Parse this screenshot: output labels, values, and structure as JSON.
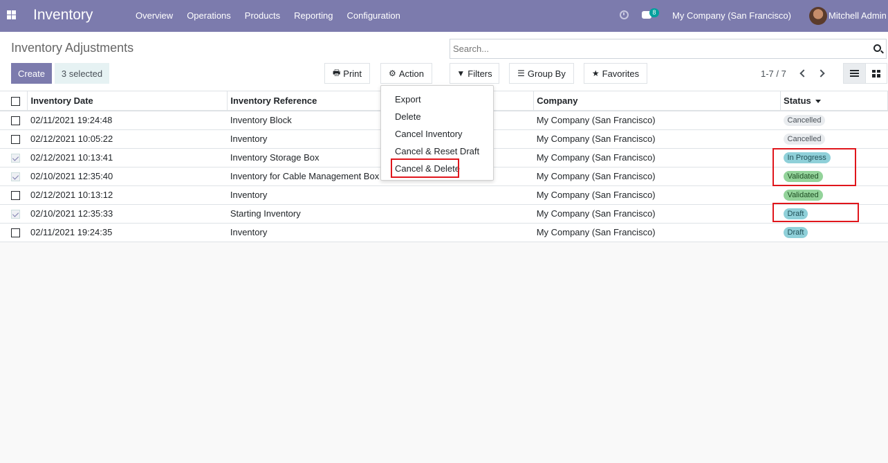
{
  "navbar": {
    "app_title": "Inventory",
    "menu": [
      "Overview",
      "Operations",
      "Products",
      "Reporting",
      "Configuration"
    ],
    "chat_count": "8",
    "company": "My Company (San Francisco)",
    "user": "Mitchell Admin",
    "bg_color": "#7c7bad"
  },
  "control_panel": {
    "title": "Inventory Adjustments",
    "create_label": "Create",
    "selected_label": "3 selected",
    "print_label": "Print",
    "action_label": "Action",
    "search_placeholder": "Search...",
    "filters_label": "Filters",
    "groupby_label": "Group By",
    "favorites_label": "Favorites",
    "pager": "1-7 / 7"
  },
  "action_menu": [
    "Export",
    "Delete",
    "Cancel Inventory",
    "Cancel & Reset Draft",
    "Cancel & Delete"
  ],
  "table": {
    "columns": [
      "Inventory Date",
      "Inventory Reference",
      "Company",
      "Status"
    ],
    "rows": [
      {
        "checked": false,
        "date": "02/11/2021 19:24:48",
        "reference": "Inventory Block",
        "company": "My Company (San Francisco)",
        "status": "Cancelled"
      },
      {
        "checked": false,
        "date": "02/12/2021 10:05:22",
        "reference": "Inventory",
        "company": "My Company (San Francisco)",
        "status": "Cancelled"
      },
      {
        "checked": true,
        "date": "02/12/2021 10:13:41",
        "reference": "Inventory Storage Box",
        "company": "My Company (San Francisco)",
        "status": "In Progress"
      },
      {
        "checked": true,
        "date": "02/10/2021 12:35:40",
        "reference": "Inventory for Cable Management Box",
        "company": "My Company (San Francisco)",
        "status": "Validated"
      },
      {
        "checked": false,
        "date": "02/12/2021 10:13:12",
        "reference": "Inventory",
        "company": "My Company (San Francisco)",
        "status": "Validated"
      },
      {
        "checked": true,
        "date": "02/10/2021 12:35:33",
        "reference": "Starting Inventory",
        "company": "My Company (San Francisco)",
        "status": "Draft"
      },
      {
        "checked": false,
        "date": "02/11/2021 19:24:35",
        "reference": "Inventory",
        "company": "My Company (San Francisco)",
        "status": "Draft"
      }
    ]
  },
  "status_colors": {
    "Cancelled": {
      "bg": "#e9ecef",
      "fg": "#495057"
    },
    "In Progress": {
      "bg": "#8fd0d9",
      "fg": "#1f4e55"
    },
    "Validated": {
      "bg": "#93d39a",
      "fg": "#1e4d23"
    },
    "Draft": {
      "bg": "#8fd0d9",
      "fg": "#1f4e55"
    }
  },
  "highlight_color": "#e0151b"
}
